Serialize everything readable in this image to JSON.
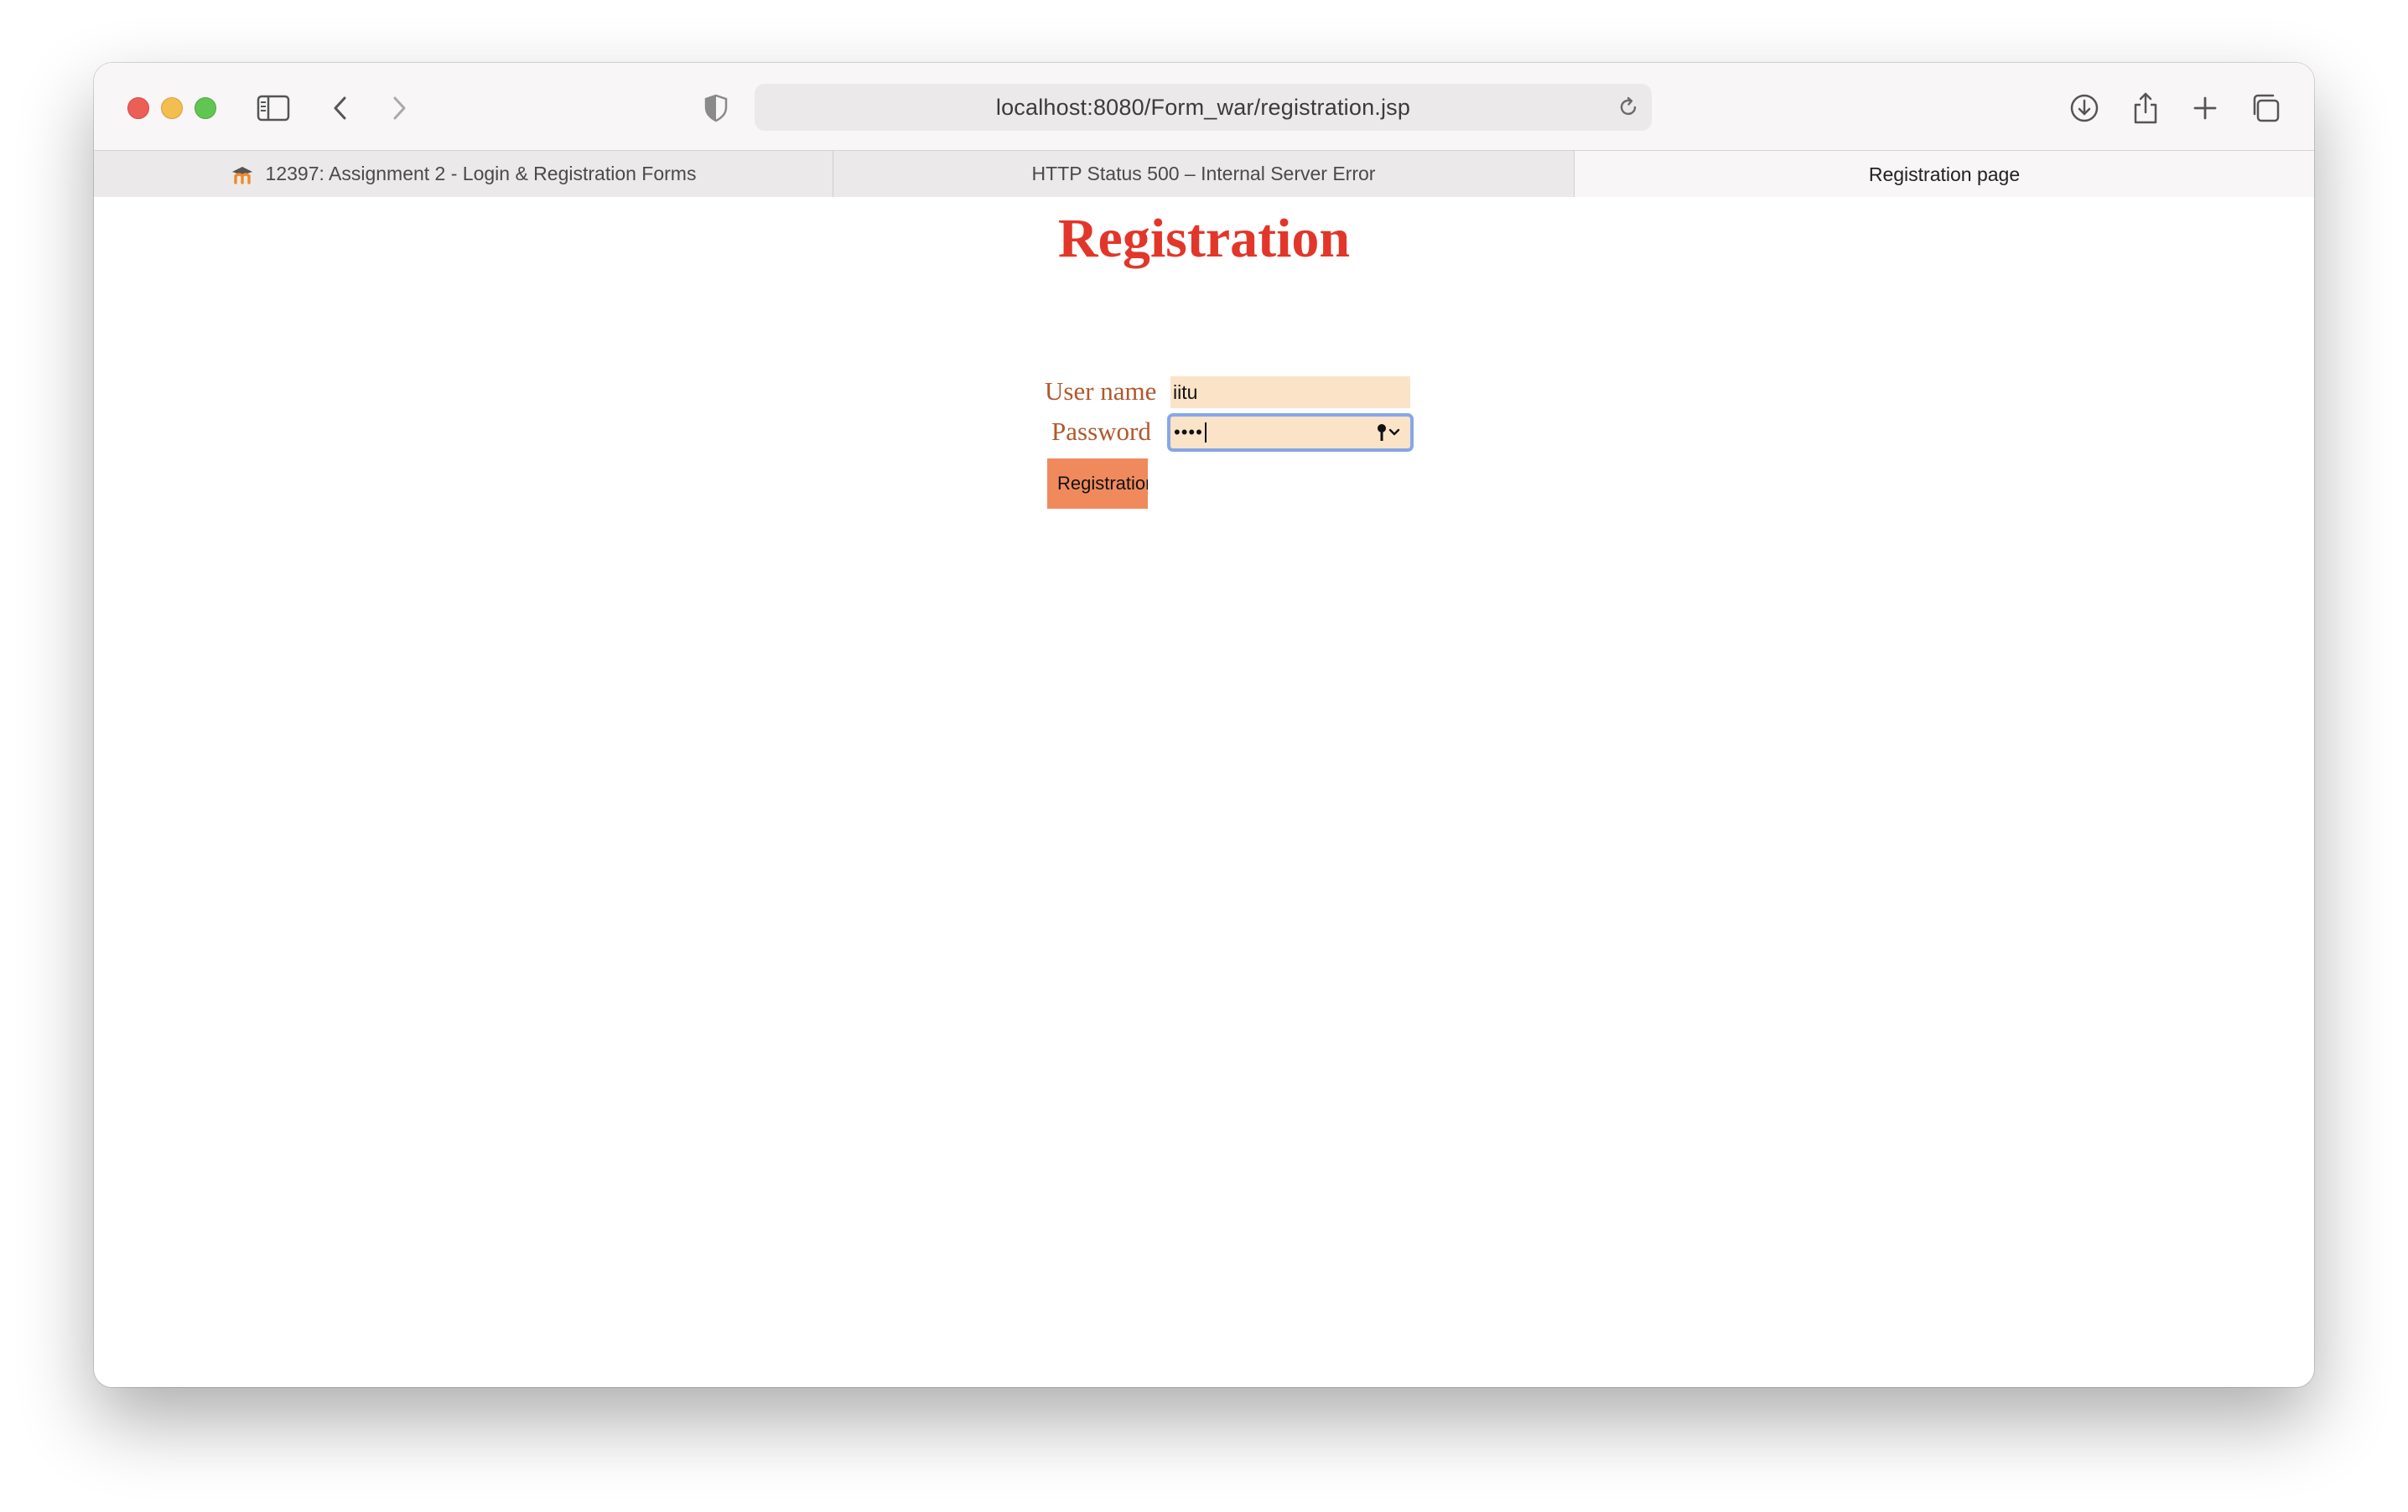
{
  "browser": {
    "url": "localhost:8080/Form_war/registration.jsp",
    "tabs": [
      {
        "label": "12397: Assignment 2 - Login & Registration Forms",
        "favicon": "moodle-icon",
        "active": false
      },
      {
        "label": "HTTP Status 500 – Internal Server Error",
        "active": false
      },
      {
        "label": "Registration page",
        "active": true
      }
    ],
    "colors": {
      "accent": "#86a7e6"
    }
  },
  "page": {
    "heading": "Registration",
    "form": {
      "username_label": "User name",
      "username_value": "iitu",
      "password_label": "Password",
      "password_masked": "••••",
      "submit_label": "Registration"
    },
    "colors": {
      "heading": "#e2362a",
      "label": "#b1582c",
      "input_bg": "#fbe3c8",
      "button_bg": "#f08a5d"
    }
  }
}
